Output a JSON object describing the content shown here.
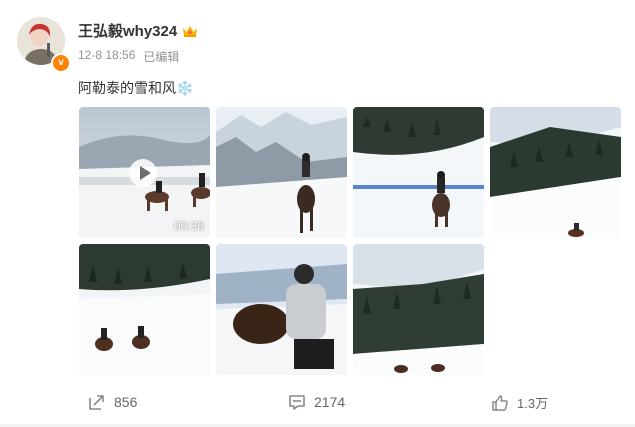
{
  "user": {
    "name": "王弘毅why324",
    "verified_color": "#ff8200"
  },
  "post": {
    "date": "12-8 18:56",
    "edited_label": "已编辑",
    "text": "阿勒泰的雪和风❄️"
  },
  "media": {
    "video_duration": "00:36",
    "items": [
      {
        "type": "video",
        "icon": "play-icon"
      },
      {
        "type": "image"
      },
      {
        "type": "image"
      },
      {
        "type": "image"
      },
      {
        "type": "image"
      },
      {
        "type": "image"
      },
      {
        "type": "image"
      }
    ]
  },
  "actions": {
    "repost_count": "856",
    "comment_count": "2174",
    "like_count": "1.3万"
  },
  "colors": {
    "text": "#333333",
    "meta": "#939393",
    "accent": "#ff8200"
  }
}
